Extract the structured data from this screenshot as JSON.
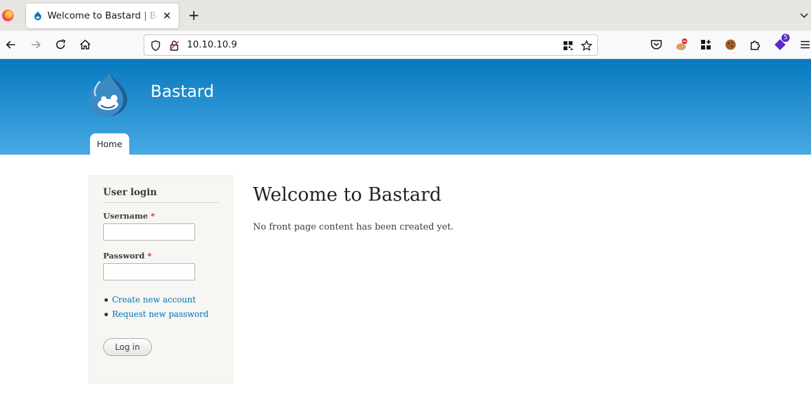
{
  "browser": {
    "tab": {
      "title": "Welcome to Bastard | Bastard"
    },
    "url": "10.10.10.9",
    "extension_badge": "5"
  },
  "site": {
    "name": "Bastard",
    "menu": [
      {
        "label": "Home"
      }
    ]
  },
  "login_block": {
    "title": "User login",
    "username_label": "Username",
    "password_label": "Password",
    "required_mark": "*",
    "username_value": "",
    "password_value": "",
    "links": [
      "Create new account",
      "Request new password"
    ],
    "submit_label": "Log in"
  },
  "main": {
    "title": "Welcome to Bastard",
    "body": "No front page content has been created yet."
  },
  "colors": {
    "header_top": "#0779bf",
    "header_bottom": "#48a9e4",
    "link": "#0071b3",
    "required": "#e31e1e"
  }
}
